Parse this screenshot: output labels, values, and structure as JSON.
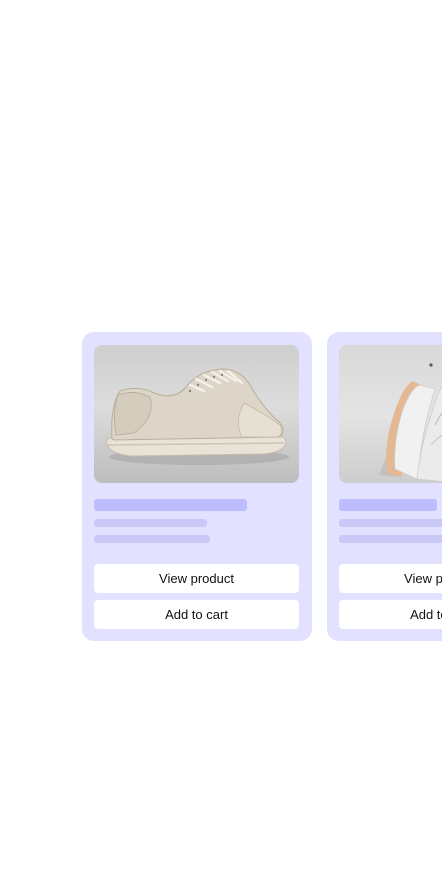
{
  "carousel": {
    "products": [
      {
        "image_alt": "cream low-top canvas sneaker",
        "view_label": "View product",
        "cart_label": "Add to cart"
      },
      {
        "image_alt": "white and orange running sneaker",
        "view_label": "View product",
        "cart_label": "Add to cart"
      }
    ]
  },
  "colors": {
    "card_background": "#e2e1ff",
    "skeleton_title": "#bcbcff",
    "skeleton_line": "#c9c8f7",
    "button_background": "#ffffff",
    "button_text": "#111111"
  }
}
